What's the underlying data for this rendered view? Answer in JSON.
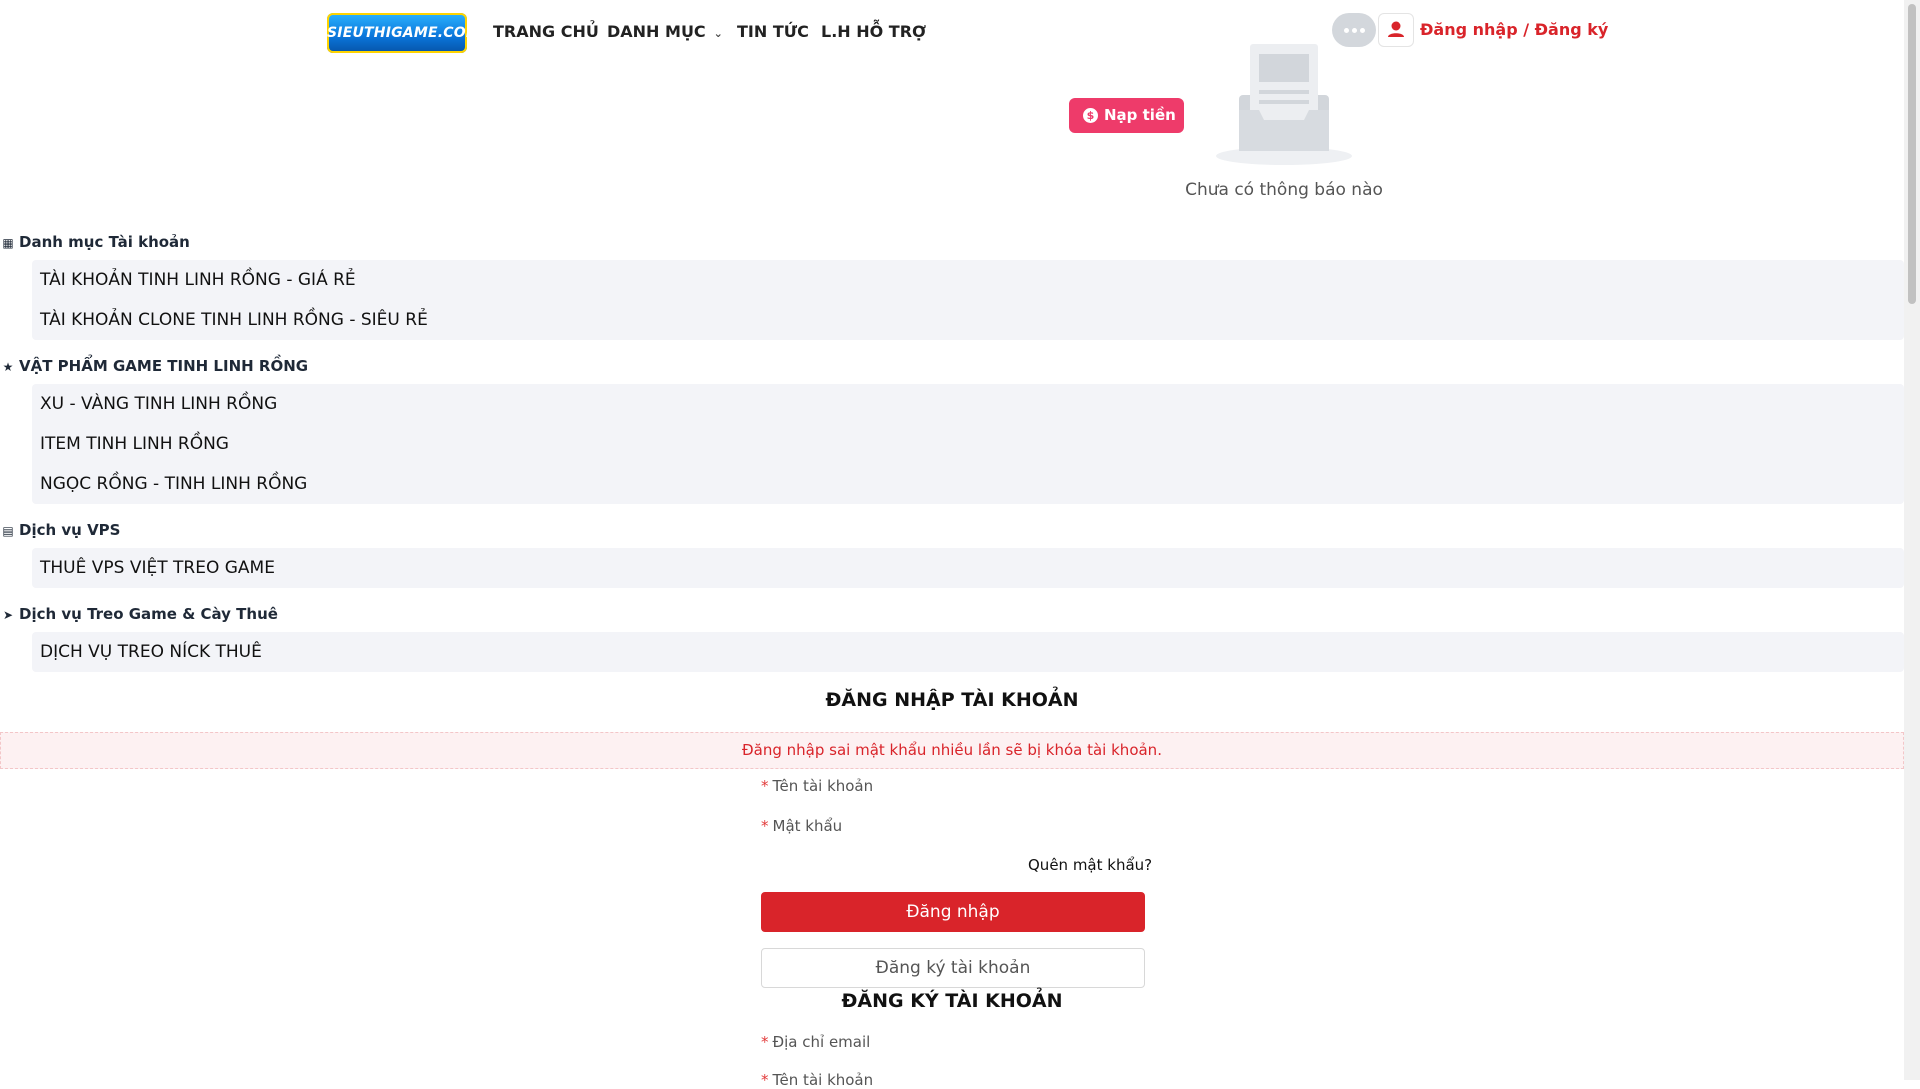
{
  "header": {
    "logo_text": "SIEUTHIGAME.COM",
    "nav": [
      {
        "label": "TRANG CHỦ"
      },
      {
        "label": "DANH MỤC"
      },
      {
        "label": "TIN TỨC"
      },
      {
        "label": "L.H HỖ TRỢ"
      }
    ],
    "login_label": "Đăng nhập / Đăng ký",
    "topup_label": "Nạp tiền",
    "topup_icon": "$",
    "notification_empty": "Chưa có thông báo nào"
  },
  "categories": [
    {
      "title": "Danh mục Tài khoản",
      "icon": "grid-icon",
      "items": [
        "TÀI KHOẢN TINH LINH RỒNG - GIÁ RẺ",
        "TÀI KHOẢN CLONE TINH LINH RỒNG - SIÊU RẺ"
      ]
    },
    {
      "title": "VẬT PHẨM GAME TINH LINH RỒNG",
      "icon": "star-icon",
      "items": [
        "XU - VÀNG TINH LINH RỒNG",
        "ITEM TINH LINH RỒNG",
        "NGỌC RỒNG - TINH LINH RỒNG"
      ]
    },
    {
      "title": "Dịch vụ VPS",
      "icon": "server-icon",
      "items": [
        "THUÊ VPS VIỆT TREO GAME"
      ]
    },
    {
      "title": "Dịch vụ Treo Game & Cày Thuê",
      "icon": "rocket-icon",
      "items": [
        "DỊCH VỤ TREO NÍCK THUÊ"
      ]
    }
  ],
  "login": {
    "title": "ĐĂNG NHẬP TÀI KHOẢN",
    "warning": "Đăng nhập sai mật khẩu nhiều lần sẽ bị khóa tài khoản.",
    "username_label": "Tên tài khoản",
    "password_label": "Mật khẩu",
    "forgot_label": "Quên mật khẩu?",
    "submit_label": "Đăng nhập",
    "register_label": "Đăng ký tài khoản",
    "required_mark": "*"
  },
  "register": {
    "title": "ĐĂNG KÝ TÀI KHOẢN",
    "email_label": "Địa chỉ email",
    "username_label": "Tên tài khoản"
  },
  "colors": {
    "accent_red": "#d9242a",
    "topup_pink": "#ee3b6a",
    "menu_bg": "#f3f4f8"
  }
}
